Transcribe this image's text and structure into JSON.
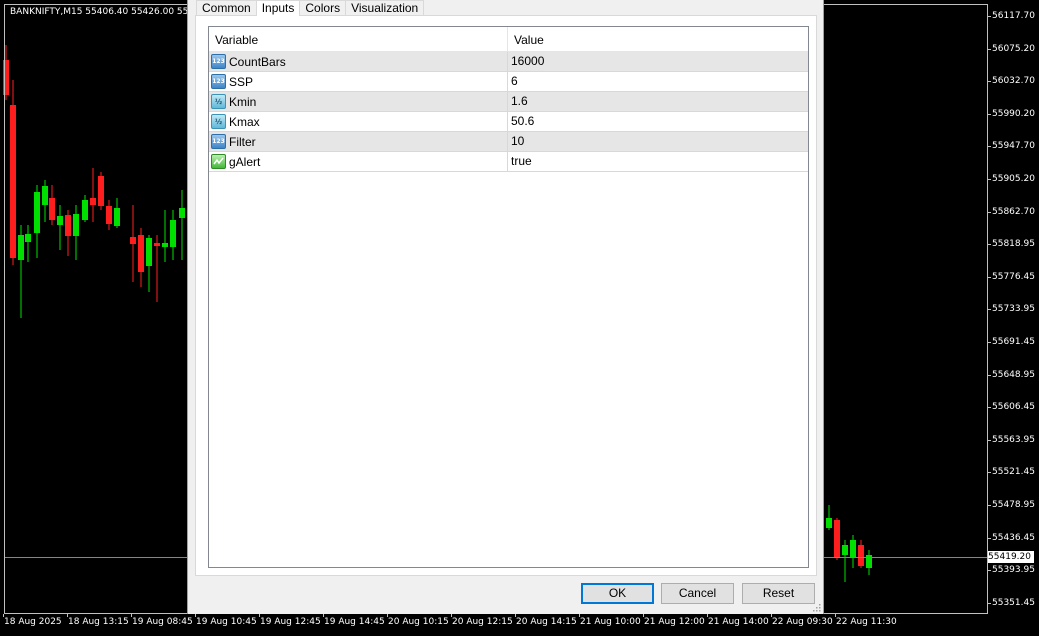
{
  "chart": {
    "title": "BANKNIFTY,M15  55406.40 55426.00 554",
    "current_price": "55419.20",
    "price_labels": [
      "56117.70",
      "56075.20",
      "56032.70",
      "55990.20",
      "55947.70",
      "55905.20",
      "55862.70",
      "55818.95",
      "55776.45",
      "55733.95",
      "55691.45",
      "55648.95",
      "55606.45",
      "55563.95",
      "55521.45",
      "55478.95",
      "55436.45",
      "55393.95",
      "55351.45"
    ],
    "time_labels": [
      "18 Aug 2025",
      "18 Aug 13:15",
      "19 Aug 08:45",
      "19 Aug 10:45",
      "19 Aug 12:45",
      "19 Aug 14:45",
      "20 Aug 10:15",
      "20 Aug 12:15",
      "20 Aug 14:15",
      "21 Aug 10:00",
      "21 Aug 12:00",
      "21 Aug 14:00",
      "22 Aug 09:30",
      "22 Aug 11:30"
    ],
    "colors": {
      "bull": "#00e000",
      "bear": "#ff1e1e",
      "background": "#000000",
      "grid_text": "#ffffff"
    }
  },
  "dialog": {
    "tabs": [
      {
        "label": "Common",
        "active": false
      },
      {
        "label": "Inputs",
        "active": true
      },
      {
        "label": "Colors",
        "active": false
      },
      {
        "label": "Visualization",
        "active": false
      }
    ],
    "columns": {
      "variable": "Variable",
      "value": "Value"
    },
    "rows": [
      {
        "name": "CountBars",
        "value": "16000",
        "type": "int",
        "icon": "integer-type-icon"
      },
      {
        "name": "SSP",
        "value": "6",
        "type": "int",
        "icon": "integer-type-icon"
      },
      {
        "name": "Kmin",
        "value": "1.6",
        "type": "double",
        "icon": "double-type-icon"
      },
      {
        "name": "Kmax",
        "value": "50.6",
        "type": "double",
        "icon": "double-type-icon"
      },
      {
        "name": "Filter",
        "value": "10",
        "type": "int",
        "icon": "integer-type-icon"
      },
      {
        "name": "gAlert",
        "value": "true",
        "type": "bool",
        "icon": "boolean-type-icon"
      }
    ],
    "buttons": {
      "ok": "OK",
      "cancel": "Cancel",
      "reset": "Reset"
    }
  }
}
